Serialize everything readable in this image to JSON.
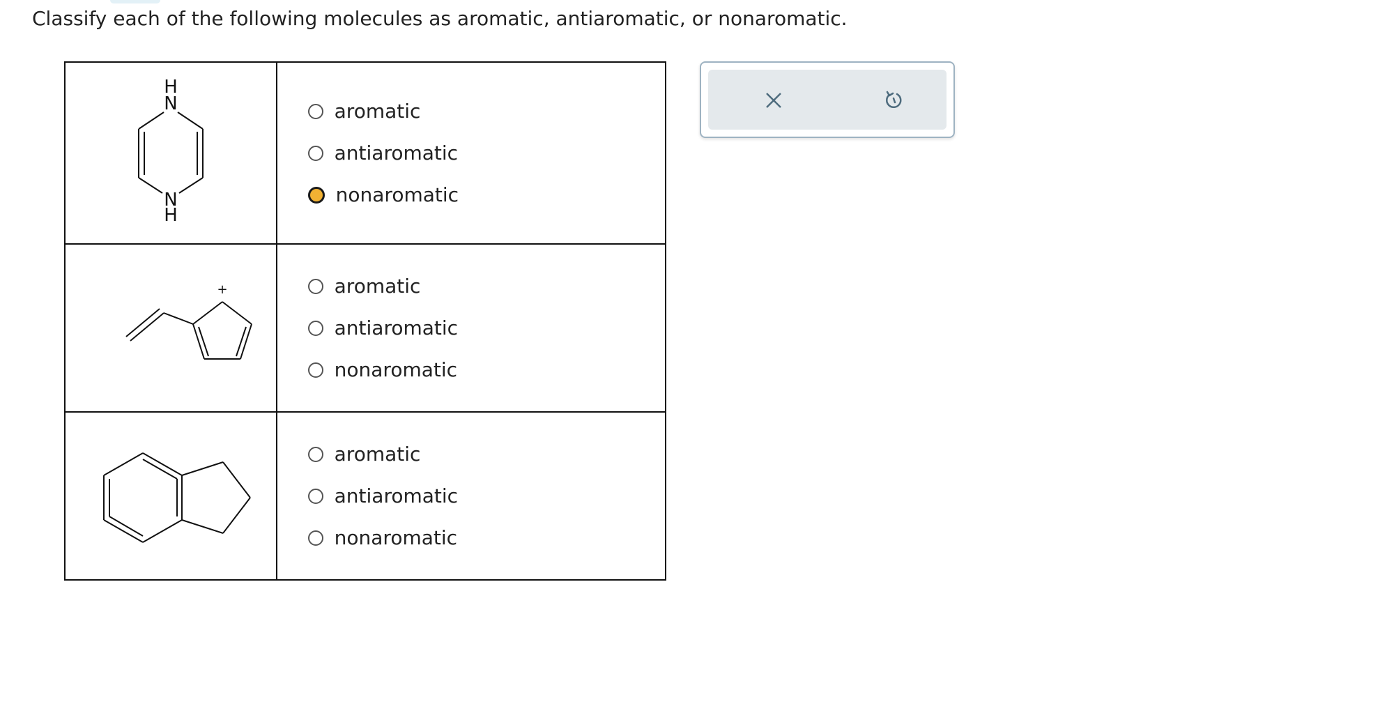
{
  "question": "Classify each of the following molecules as aromatic, antiaromatic, or nonaromatic.",
  "rows": [
    {
      "structure": {
        "name": "dihydropyrazine",
        "labels": {
          "top_h": "H",
          "top_n": "N",
          "bottom_n": "N",
          "bottom_h": "H"
        }
      },
      "options": [
        {
          "label": "aromatic",
          "selected": false
        },
        {
          "label": "antiaromatic",
          "selected": false
        },
        {
          "label": "nonaromatic",
          "selected": true
        }
      ]
    },
    {
      "structure": {
        "name": "vinylcyclopentadienyl-cation",
        "labels": {
          "charge": "+"
        }
      },
      "options": [
        {
          "label": "aromatic",
          "selected": false
        },
        {
          "label": "antiaromatic",
          "selected": false
        },
        {
          "label": "nonaromatic",
          "selected": false
        }
      ]
    },
    {
      "structure": {
        "name": "indane",
        "labels": {}
      },
      "options": [
        {
          "label": "aromatic",
          "selected": false
        },
        {
          "label": "antiaromatic",
          "selected": false
        },
        {
          "label": "nonaromatic",
          "selected": false
        }
      ]
    }
  ],
  "toolbar": {
    "clear_icon": "x-icon",
    "undo_icon": "undo-icon"
  },
  "colors": {
    "selected_radio": "#f2b233",
    "toolbar_bg": "#e4e9ec",
    "toolbar_border": "#9eb3c2",
    "icon": "#4d6b7d"
  }
}
